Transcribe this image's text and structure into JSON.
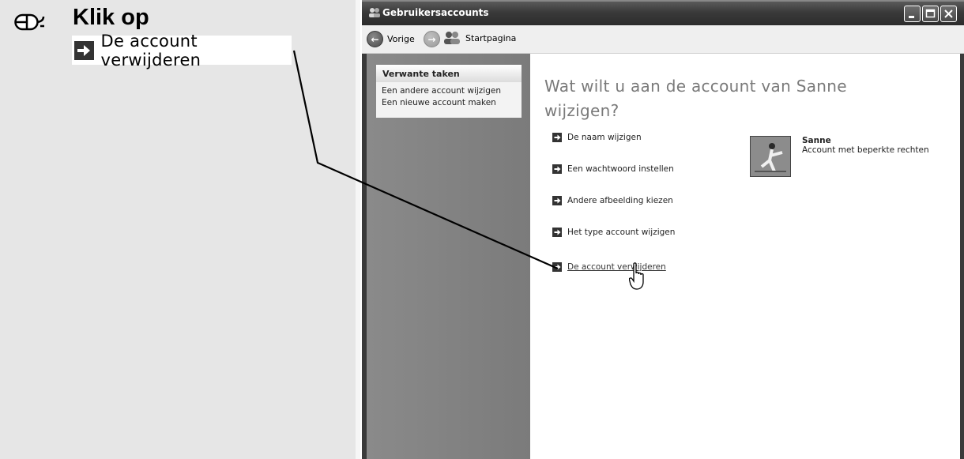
{
  "instruction": {
    "title": "Klik op",
    "target_label": "De account verwijderen",
    "icon": "mouse-icon"
  },
  "window": {
    "title": "Gebruikersaccounts",
    "controls": [
      "minimize-icon",
      "maximize-icon",
      "close-icon"
    ]
  },
  "toolbar": {
    "back_label": "Vorige",
    "home_label": "Startpagina"
  },
  "sidebar": {
    "header": "Verwante taken",
    "links": [
      "Een andere account wijzigen",
      "Een nieuwe account maken"
    ]
  },
  "main": {
    "question": "Wat wilt u aan de account van Sanne wijzigen?",
    "actions": [
      "De naam wijzigen",
      "Een wachtwoord instellen",
      "Andere afbeelding kiezen",
      "Het type account wijzigen",
      "De account verwijderen"
    ],
    "account": {
      "name": "Sanne",
      "type": "Account met beperkte rechten"
    }
  }
}
